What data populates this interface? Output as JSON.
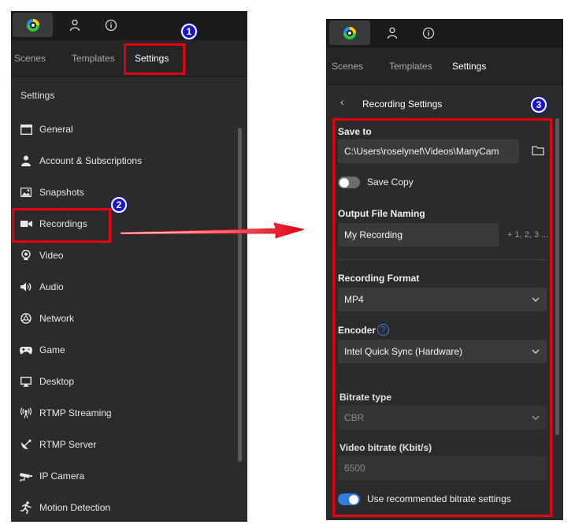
{
  "colors": {
    "panel_bg": "#2b2b2d",
    "topbar_bg": "#1b1b1c",
    "highlight": "#e3000f",
    "badge_blue": "#1515c9",
    "toggle_on": "#2f7de0",
    "toggle_off": "#6d6d70"
  },
  "left": {
    "tabs": [
      "Scenes",
      "Templates",
      "Settings"
    ],
    "section_title": "Settings",
    "menu": [
      {
        "label": "General",
        "icon": "window-icon"
      },
      {
        "label": "Account & Subscriptions",
        "icon": "user-icon"
      },
      {
        "label": "Snapshots",
        "icon": "image-icon"
      },
      {
        "label": "Recordings",
        "icon": "video-camera-icon"
      },
      {
        "label": "Video",
        "icon": "webcam-icon"
      },
      {
        "label": "Audio",
        "icon": "speaker-icon"
      },
      {
        "label": "Network",
        "icon": "network-icon"
      },
      {
        "label": "Game",
        "icon": "gamepad-icon"
      },
      {
        "label": "Desktop",
        "icon": "monitor-icon"
      },
      {
        "label": "RTMP Streaming",
        "icon": "broadcast-icon"
      },
      {
        "label": "RTMP Server",
        "icon": "satellite-icon"
      },
      {
        "label": "IP Camera",
        "icon": "cctv-icon"
      },
      {
        "label": "Motion Detection",
        "icon": "running-person-icon"
      }
    ]
  },
  "right": {
    "tabs": [
      "Scenes",
      "Templates",
      "Settings"
    ],
    "header_title": "Recording Settings",
    "save_to": {
      "label": "Save to",
      "value": "C:\\Users\\roselynef\\Videos\\ManyCam"
    },
    "save_copy": {
      "label": "Save Copy",
      "on": false
    },
    "output_naming": {
      "label": "Output File Naming",
      "value": "My Recording",
      "suffix": "+ 1, 2, 3 ..."
    },
    "recording_format": {
      "label": "Recording Format",
      "value": "MP4"
    },
    "encoder": {
      "label": "Encoder",
      "value": "Intel Quick Sync (Hardware)",
      "help": "?"
    },
    "bitrate_type": {
      "label": "Bitrate type",
      "value": "CBR"
    },
    "video_bitrate": {
      "label": "Video bitrate (Kbit/s)",
      "value": "6500"
    },
    "recommended": {
      "label": "Use recommended bitrate settings",
      "on": true
    }
  },
  "badges": [
    "1",
    "2",
    "3"
  ]
}
